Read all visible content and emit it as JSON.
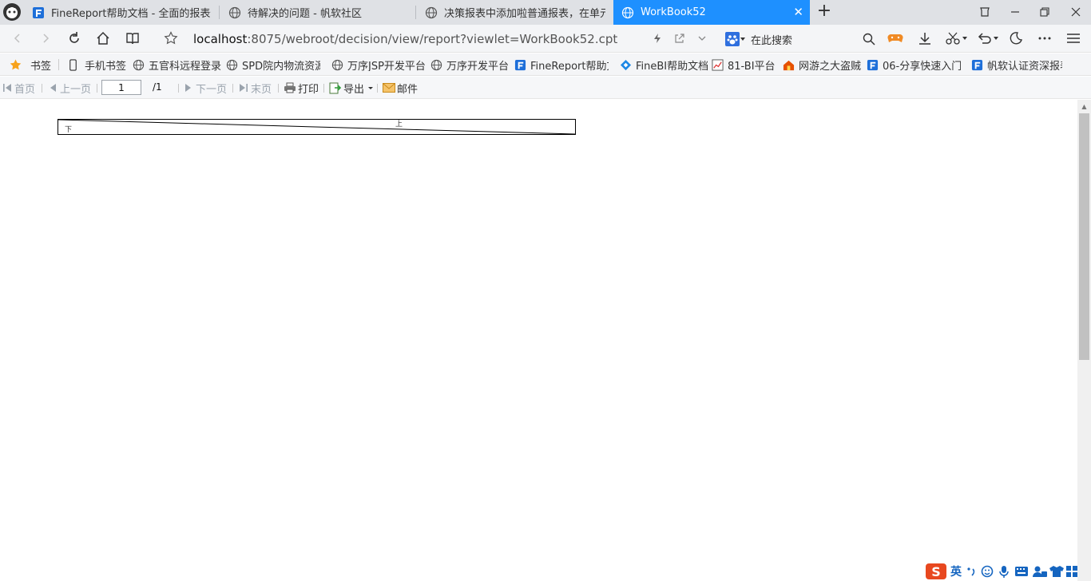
{
  "tabs": [
    {
      "title": "FineReport帮助文档 - 全面的报表使用教程&学习",
      "active": false
    },
    {
      "title": "待解决的问题 - 帆软社区",
      "active": false
    },
    {
      "title": "决策报表中添加啦普通报表，在单元格中...",
      "active": false
    },
    {
      "title": "WorkBook52",
      "active": true
    }
  ],
  "address": {
    "host": "localhost",
    "path": ":8075/webroot/decision/view/report?viewlet=WorkBook52.cpt"
  },
  "search": {
    "label": "在此搜索"
  },
  "bookmarks": [
    {
      "label": "书签",
      "icon": "star-icon"
    },
    {
      "label": "手机书签",
      "icon": "phone-icon"
    },
    {
      "label": "五官科远程登录",
      "icon": "globe-icon"
    },
    {
      "label": "SPD院内物流资源",
      "icon": "globe-icon"
    },
    {
      "label": "万序JSP开发平台",
      "icon": "globe-icon"
    },
    {
      "label": "万序开发平台",
      "icon": "globe-icon"
    },
    {
      "label": "FineReport帮助文",
      "icon": "finereport-icon"
    },
    {
      "label": "FineBI帮助文档",
      "icon": "finebi-icon"
    },
    {
      "label": "81-BI平台",
      "icon": "chart-icon"
    },
    {
      "label": "网游之大盗贼",
      "icon": "house-icon"
    },
    {
      "label": "06-分享快速入门",
      "icon": "finereport-icon"
    },
    {
      "label": "帆软认证资深报表",
      "icon": "finereport-icon"
    }
  ],
  "report_toolbar": {
    "first": "首页",
    "prev": "上一页",
    "page_value": "1",
    "page_total": "/1",
    "next": "下一页",
    "last": "末页",
    "print": "打印",
    "export": "导出",
    "mail": "邮件"
  },
  "report": {
    "diagonal_cell": {
      "lower_text": "下",
      "upper_text": "上"
    }
  },
  "ime": {
    "lang": "英"
  },
  "colors": {
    "active_tab": "#1e90ff",
    "tab_strip": "#dfe1e5",
    "toolbar": "#f4f5f7"
  }
}
